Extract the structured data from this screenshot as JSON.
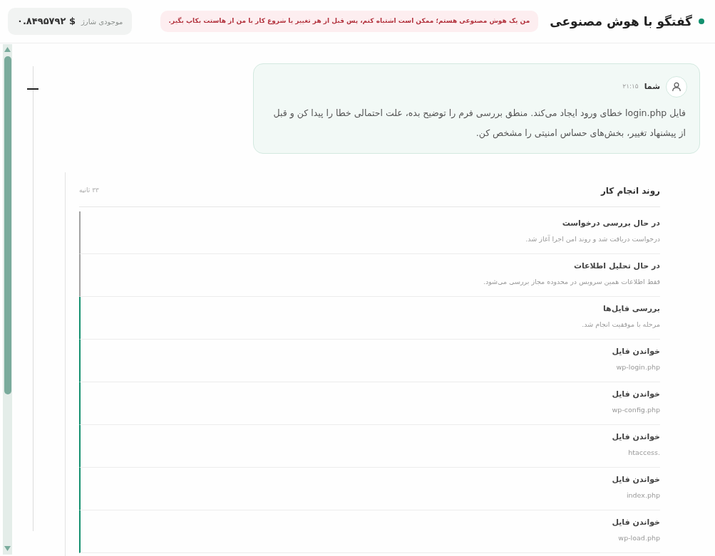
{
  "header": {
    "title": "گفتگو با هوش مصنوعی",
    "online": true,
    "notice": "من یک هوش مصنوعی هستم؛ ممکن است اشتباه کنم، پس قبل از هر تغییر یا شروع کار با من از هاستت بکاپ بگیر.",
    "balance": {
      "label": "موجودی شارژ",
      "amount": "۰.۸۴۹۵۷۹۲ $"
    }
  },
  "messages": [
    {
      "sender": "شما",
      "time": "۲۱:۱۵",
      "text": "فایل login.php خطای ورود ایجاد می‌کند. منطق بررسی فرم را توضیح بده، علت احتمالی خطا را پیدا کن و قبل از پیشنهاد تغییر، بخش‌های حساس امنیتی را مشخص کن."
    }
  ],
  "process": {
    "title": "روند انجام کار",
    "duration": "۳۳ ثانیه",
    "steps": [
      {
        "title": "در حال بررسی درخواست",
        "detail": "درخواست دریافت شد و روند امن اجرا آغاز شد.",
        "done": false
      },
      {
        "title": "در حال تحلیل اطلاعات",
        "detail": "فقط اطلاعات همین سرویس در محدوده مجاز بررسی می‌شود.",
        "done": false
      },
      {
        "title": "بررسی فایل‌ها",
        "detail": "مرحله با موفقیت انجام شد.",
        "done": true
      },
      {
        "title": "خواندن فایل",
        "detail": "wp-login.php",
        "done": true
      },
      {
        "title": "خواندن فایل",
        "detail": "wp-config.php",
        "done": true
      },
      {
        "title": "خواندن فایل",
        "detail": ".htaccess",
        "done": true
      },
      {
        "title": "خواندن فایل",
        "detail": "index.php",
        "done": true
      },
      {
        "title": "خواندن فایل",
        "detail": "wp-load.php",
        "done": true
      }
    ]
  }
}
